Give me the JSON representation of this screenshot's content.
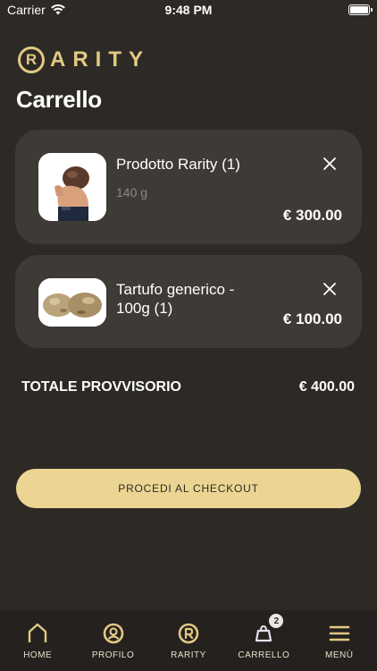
{
  "status_bar": {
    "carrier": "Carrier",
    "time": "9:48 PM"
  },
  "brand": {
    "mark": "R",
    "name": "ARITY",
    "color": "#e2c983"
  },
  "page_title": "Carrello",
  "cart_items": [
    {
      "name": "Prodotto Rarity (1)",
      "weight": "140 g",
      "price": "€ 300.00",
      "thumb": "truffle-hand-image"
    },
    {
      "name": "Tartufo generico - 100g (1)",
      "weight": "",
      "price": "€ 100.00",
      "thumb": "truffles-image"
    }
  ],
  "summary": {
    "label": "TOTALE PROVVISORIO",
    "value": "€ 400.00"
  },
  "checkout": {
    "label": "PROCEDI AL CHECKOUT",
    "color": "#ecd593"
  },
  "tabs": [
    {
      "label": "HOME",
      "icon": "home-icon"
    },
    {
      "label": "PROFILO",
      "icon": "profile-icon"
    },
    {
      "label": "RARITY",
      "icon": "rarity-icon"
    },
    {
      "label": "CARRELLO",
      "icon": "cart-icon",
      "badge": "2"
    },
    {
      "label": "MENÙ",
      "icon": "menu-icon"
    }
  ]
}
